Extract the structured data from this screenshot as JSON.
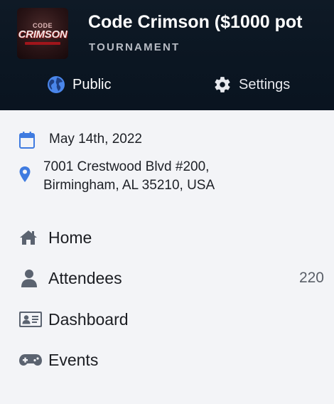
{
  "header": {
    "title": "Code Crimson ($1000 pot",
    "subtitle": "TOURNAMENT",
    "logo_text_top": "CODE",
    "logo_text_main": "CRIMSON",
    "tabs": [
      {
        "label": "Public",
        "icon": "globe-icon"
      },
      {
        "label": "Settings",
        "icon": "gear-icon"
      }
    ]
  },
  "details": {
    "date": "May 14th, 2022",
    "address_line1": "7001 Crestwood Blvd #200,",
    "address_line2": "Birmingham, AL 35210, USA"
  },
  "nav": {
    "items": [
      {
        "label": "Home",
        "icon": "home-icon"
      },
      {
        "label": "Attendees",
        "icon": "person-icon",
        "count": "220"
      },
      {
        "label": "Dashboard",
        "icon": "id-card-icon"
      },
      {
        "label": "Events",
        "icon": "gamepad-icon"
      }
    ]
  },
  "colors": {
    "header_bg": "#0b1622",
    "accent_blue": "#3f7be0",
    "page_bg": "#f3f4f7",
    "icon_gray": "#5b6370"
  }
}
